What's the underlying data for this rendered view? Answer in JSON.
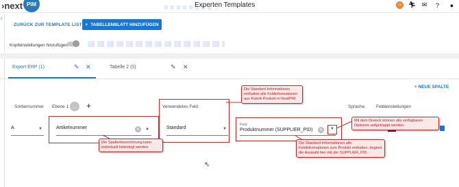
{
  "app": {
    "logo_text": "›next",
    "logo_badge": "PIM",
    "title": "Experten Templates"
  },
  "topbar": {
    "icons": [
      "user-avatar-icon",
      "run-icon",
      "mail-icon",
      "help-icon",
      "account-icon"
    ]
  },
  "toolbar": {
    "back_label": "ZURÜCK ZUR TEMPLATE LISTE",
    "add_sheet_label": "TABELLENBLATT HINZUFÜGEN",
    "header_toggle_label": "Kopfeinstellungen hinzufügen"
  },
  "tabs": [
    {
      "label": "Export ERP (1)",
      "active": true
    },
    {
      "label": "Tabelle 2 (0)",
      "active": false
    }
  ],
  "new_column_label": "NEUE SPALTE",
  "columns": {
    "sort": "Sortiernummer",
    "level": "Ebene 1",
    "used_field": "Verwendetes Feld",
    "language": "Sprache",
    "field_settings": "Feldeinstellungen"
  },
  "row": {
    "sort_value": "A",
    "name_value": "Artikelnummer",
    "used_field_value": "Standard",
    "field_label": "Feld",
    "field_value": "Produktnummer (SUPPLIER_PID)"
  },
  "callouts": {
    "standard": "Die Standard Informationen enthalten alle Feldinformationen aus Rubrik Produkt in NextPIM.",
    "column_name": "Die Spaltenbezeichnung kann individuell hinterlegt werden.",
    "triangle": "Mit dem Dreieck können alle verfügbaren Optionen aufgeklappt werden.",
    "field": "Die Standard Informationen alle Feldinformationen zum Produkt enthalten, beginnt die Auswahl hier mit der SUPPLIER_PID."
  },
  "accent": "#1976d2",
  "annotation_color": "#c62828"
}
